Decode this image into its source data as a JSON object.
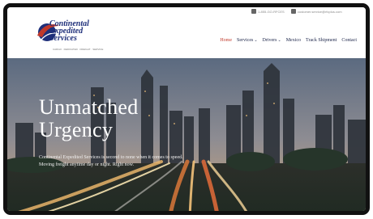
{
  "topbar": {
    "phone": "1-855-GO-RFCES",
    "email": "customer.service@rfcplus.com"
  },
  "logo": {
    "name_line1": "Continental",
    "name_line2": "Expedited",
    "name_line3": "Services",
    "tagline": "CARGO · DEDICATED · FREIGHT · SERVICE"
  },
  "nav": {
    "items": [
      {
        "label": "Home",
        "active": true
      },
      {
        "label": "Services",
        "has_dropdown": true
      },
      {
        "label": "Drivers",
        "has_dropdown": true
      },
      {
        "label": "Mexico"
      },
      {
        "label": "Track Shipment"
      },
      {
        "label": "Contact"
      }
    ]
  },
  "hero": {
    "headline_line1": "Unmatched",
    "headline_line2": "Urgency",
    "subtext_line1": "Continental Expedited Services is second to none when it comes to speed.",
    "subtext_line2": "Moving freight anytime day or night. Right now."
  },
  "colors": {
    "accent": "#c0392b",
    "nav_text": "#1a2348",
    "brand_blue": "#1e2f7a"
  }
}
